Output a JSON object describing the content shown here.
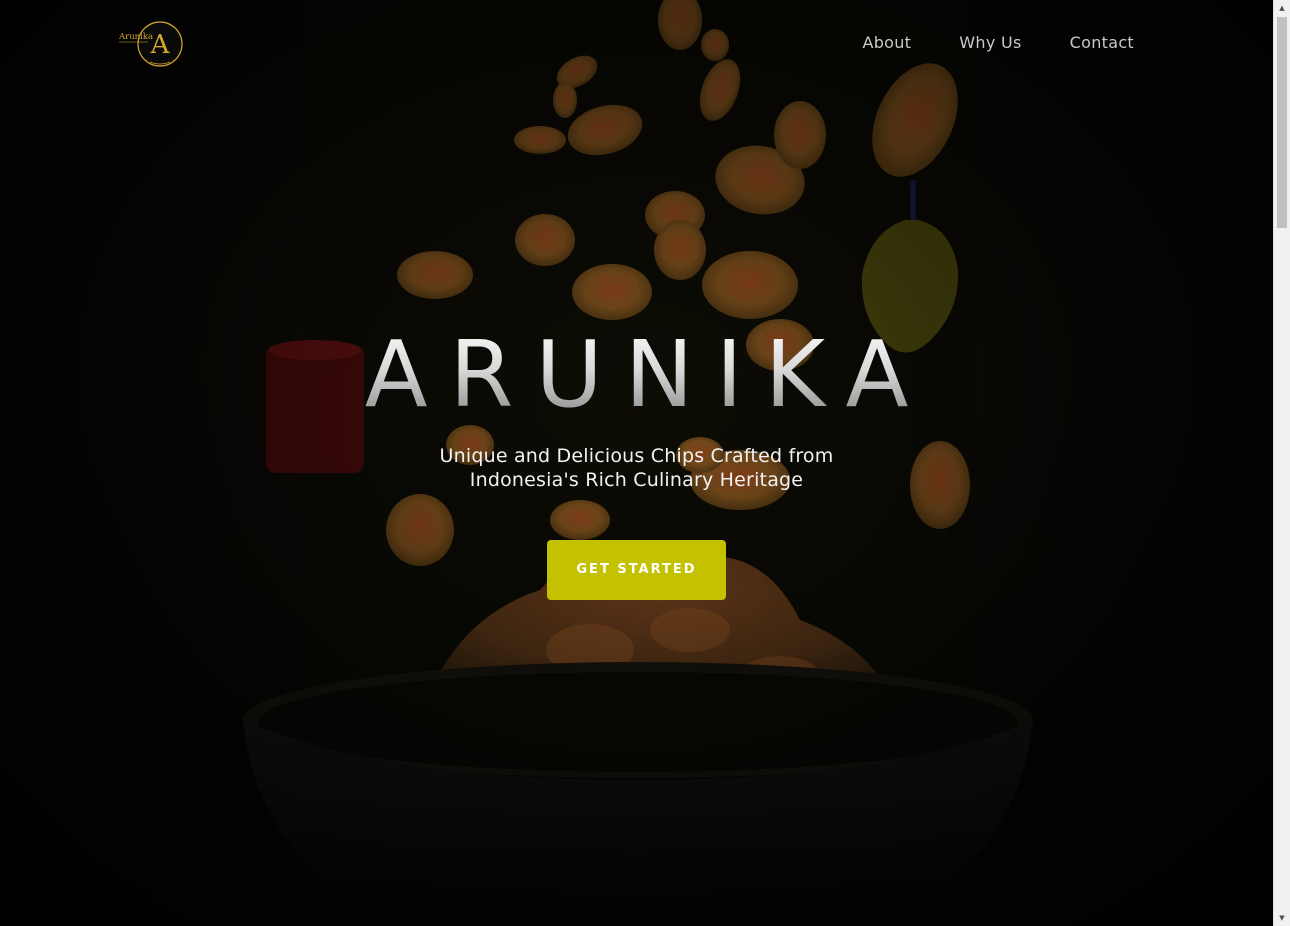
{
  "brand": {
    "logo_text": "Arunika",
    "logo_letter": "A",
    "accent_color": "#c4c100",
    "gold_color": "#d4a72c"
  },
  "nav": {
    "items": [
      {
        "label": "About"
      },
      {
        "label": "Why Us"
      },
      {
        "label": "Contact"
      }
    ]
  },
  "hero": {
    "title": "ARUNIKA",
    "subtitle": "Unique and Delicious Chips Crafted from Indonesia's Rich Culinary Heritage",
    "cta_label": "GET STARTED"
  },
  "scrollbar": {
    "up_icon": "triangle-up-icon",
    "down_icon": "triangle-down-icon"
  }
}
